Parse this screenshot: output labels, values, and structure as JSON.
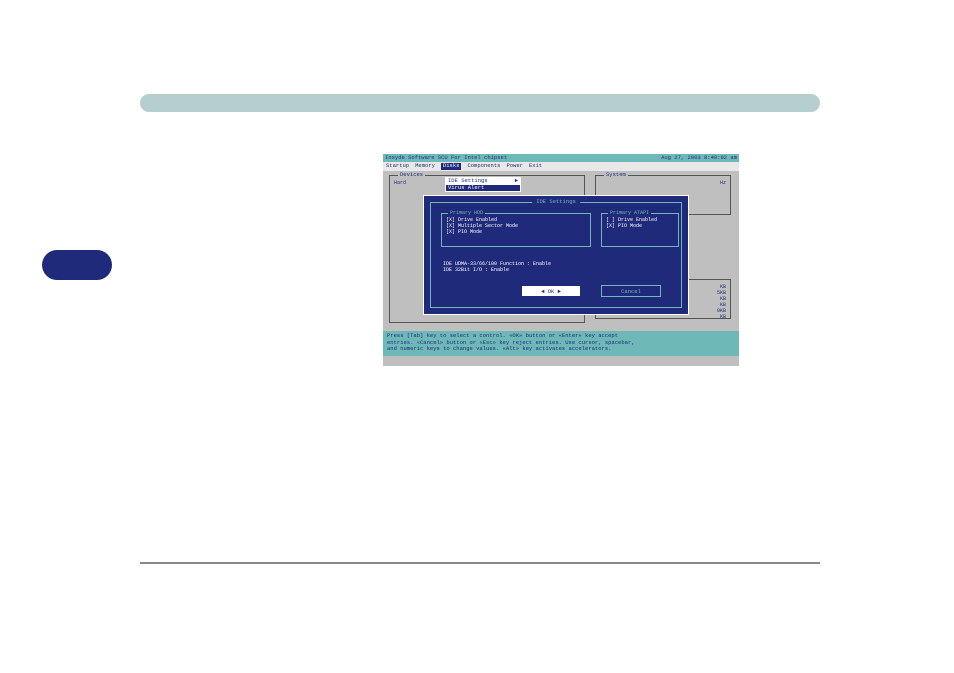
{
  "titlebar": {
    "left": "Insyde Software SCU For Intel chipset",
    "right": "Aug 27, 2003  8:40:02 am"
  },
  "menubar": [
    "Startup",
    "Memory",
    "Disks",
    "Components",
    "Power",
    "Exit"
  ],
  "active_menu_index": 2,
  "dropdown": {
    "items": [
      "IDE Settings",
      "Virus Alert"
    ],
    "selected_index": 0,
    "arrow": "►"
  },
  "panels": {
    "devices_label": "Devices",
    "devices_body": "Hard",
    "system_label": "System",
    "system_suffix": "Hz",
    "mem_lines": [
      "KB",
      "5KB",
      "KB",
      "KB",
      "0KB",
      "KB"
    ]
  },
  "dialog": {
    "title": "IDE Settings",
    "hdd": {
      "label": "Primary HDD",
      "lines": [
        "[X] Drive Enabled",
        "[X] Multiple Sector Mode",
        "[X] PIO Mode"
      ]
    },
    "atapi": {
      "label": "Primary ATAPI",
      "lines": [
        "[ ] Drive Enabled",
        "[X] PIO Mode"
      ]
    },
    "extra": [
      "IDE UDMA-33/66/100 Function : Enable",
      "IDE 32Bit I/O :               Enable"
    ],
    "ok": "OK",
    "ok_left_arrow": "◄",
    "ok_right_arrow": "►",
    "cancel": "Cancel"
  },
  "statusbar": [
    "Press [Tab] key to select a control. «OK» button or «Enter» key accept",
    "entries. «Cancel» button or «Esc» key reject entries. Use cursor, spacebar,",
    "and numeric keys to change values.  «Alt» key activates accelerators."
  ]
}
